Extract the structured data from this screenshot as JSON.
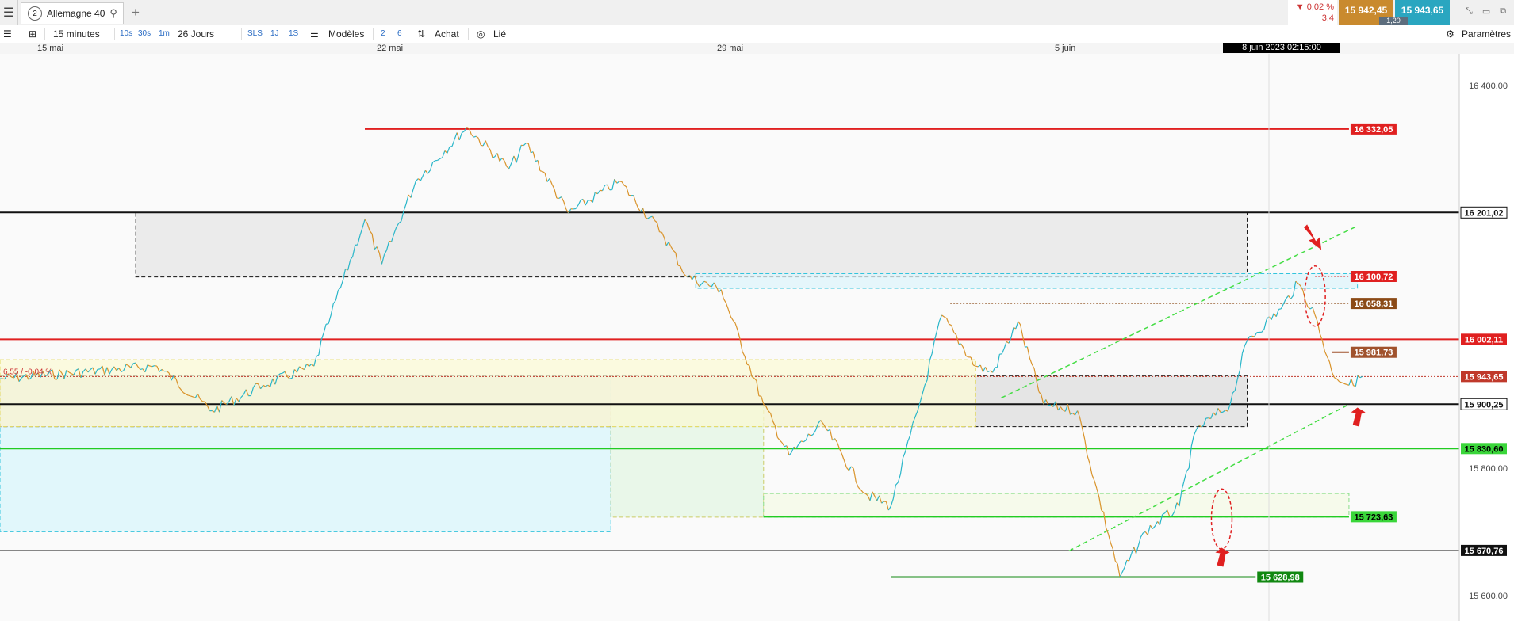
{
  "tabbar": {
    "tab_number": "2",
    "tab_title": "Allemagne 40",
    "change_pct": "▼ 0,02 %",
    "change_abs": "3,4",
    "bid": "15 942,45",
    "ask": "15 943,65",
    "spread": "1,20"
  },
  "toolbar": {
    "interval": "15 minutes",
    "q10s": "10s",
    "q30s": "30s",
    "q1m": "1m",
    "period": "26 Jours",
    "sls": "SLS",
    "q1j": "1J",
    "q1s": "1S",
    "models": "Modèles",
    "n2": "2",
    "n6": "6",
    "buy": "Achat",
    "linked": "Lié",
    "settings": "Paramètres"
  },
  "datebar": {
    "d1": "15 mai",
    "d2": "22 mai",
    "d3": "29 mai",
    "d4": "5 juin",
    "cursor": "8 juin 2023 02:15:00"
  },
  "colors": {
    "up": "#29b6c9",
    "down": "#d9932a",
    "red_line": "#e02020",
    "green_line": "#22cc22",
    "dark_green": "#118811",
    "price_tag": "#c0392b",
    "bid_color": "#c98a2e",
    "ask_color": "#2aa6c0"
  },
  "chart_data": {
    "type": "line",
    "title": "Allemagne 40",
    "x_range": [
      "2023-05-12",
      "2023-06-08"
    ],
    "ylim": [
      15560,
      16450
    ],
    "y_ticks": [
      "16 400,00",
      "15 800,00",
      "15 600,00"
    ],
    "price_series": [
      {
        "date": "2023-05-12 08:00",
        "value": 15940
      },
      {
        "date": "2023-05-15 10:00",
        "value": 15960
      },
      {
        "date": "2023-05-16 12:00",
        "value": 15890
      },
      {
        "date": "2023-05-17 12:00",
        "value": 15930
      },
      {
        "date": "2023-05-18 12:00",
        "value": 15960
      },
      {
        "date": "2023-05-18 20:00",
        "value": 16040
      },
      {
        "date": "2023-05-19 12:00",
        "value": 16190
      },
      {
        "date": "2023-05-19 20:00",
        "value": 16120
      },
      {
        "date": "2023-05-20 12:00",
        "value": 16250
      },
      {
        "date": "2023-05-21 12:00",
        "value": 16335
      },
      {
        "date": "2023-05-22 08:00",
        "value": 16270
      },
      {
        "date": "2023-05-22 16:00",
        "value": 16310
      },
      {
        "date": "2023-05-23 12:00",
        "value": 16200
      },
      {
        "date": "2023-05-24 12:00",
        "value": 16250
      },
      {
        "date": "2023-05-25 08:00",
        "value": 16170
      },
      {
        "date": "2023-05-25 20:00",
        "value": 16100
      },
      {
        "date": "2023-05-26 12:00",
        "value": 16080
      },
      {
        "date": "2023-05-27 08:00",
        "value": 15900
      },
      {
        "date": "2023-05-27 20:00",
        "value": 15820
      },
      {
        "date": "2023-05-28 12:00",
        "value": 15870
      },
      {
        "date": "2023-05-29 08:00",
        "value": 15760
      },
      {
        "date": "2023-05-29 20:00",
        "value": 15740
      },
      {
        "date": "2023-05-30 12:00",
        "value": 15930
      },
      {
        "date": "2023-05-30 20:00",
        "value": 16040
      },
      {
        "date": "2023-05-31 12:00",
        "value": 15960
      },
      {
        "date": "2023-05-31 20:00",
        "value": 15950
      },
      {
        "date": "2023-06-01 08:00",
        "value": 16030
      },
      {
        "date": "2023-06-01 20:00",
        "value": 15900
      },
      {
        "date": "2023-06-02 12:00",
        "value": 15890
      },
      {
        "date": "2023-06-02 20:00",
        "value": 15780
      },
      {
        "date": "2023-06-03 08:00",
        "value": 15629
      },
      {
        "date": "2023-06-03 20:00",
        "value": 15700
      },
      {
        "date": "2023-06-04 12:00",
        "value": 15740
      },
      {
        "date": "2023-06-04 20:00",
        "value": 15860
      },
      {
        "date": "2023-06-05 12:00",
        "value": 15900
      },
      {
        "date": "2023-06-05 20:00",
        "value": 16000
      },
      {
        "date": "2023-06-06 12:00",
        "value": 16050
      },
      {
        "date": "2023-06-06 20:00",
        "value": 16090
      },
      {
        "date": "2023-06-07 04:00",
        "value": 16040
      },
      {
        "date": "2023-06-07 12:00",
        "value": 15950
      },
      {
        "date": "2023-06-07 20:00",
        "value": 15930
      },
      {
        "date": "2023-06-08 02:15",
        "value": 15943.65
      }
    ],
    "levels": [
      {
        "value": 16332.05,
        "label": "16 332,05",
        "color": "#e02020",
        "from": "2023-05-19 12:00",
        "to": "2023-06-07 20:00"
      },
      {
        "value": 16201.02,
        "label": "16 201,02",
        "color": "#111111",
        "from": "2023-05-12 08:00",
        "to": "2023-06-10 00:00"
      },
      {
        "value": 16100.72,
        "label": "16 100,72",
        "color": "#e02020",
        "from": "2023-06-07 04:00",
        "to": "2023-06-07 20:00",
        "dotted": true
      },
      {
        "value": 16058.31,
        "label": "16 058,31",
        "color": "#8b4a16",
        "from": "2023-05-31 00:00",
        "to": "2023-06-07 20:00",
        "dotted": true
      },
      {
        "value": 16002.11,
        "label": "16 002,11",
        "color": "#e02020",
        "from": "2023-05-12 08:00",
        "to": "2023-06-10 00:00"
      },
      {
        "value": 15981.73,
        "label": "15 981,73",
        "color": "#a0522d",
        "from": "2023-06-07 12:00",
        "to": "2023-06-07 20:00"
      },
      {
        "value": 15943.65,
        "label": "15 943,65",
        "color": "#c0392b",
        "from": "2023-05-12 08:00",
        "to": "2023-06-10 00:00",
        "dotted": true
      },
      {
        "value": 15900.25,
        "label": "15 900,25",
        "color": "#111111",
        "from": "2023-05-12 08:00",
        "to": "2023-06-10 00:00"
      },
      {
        "value": 15830.6,
        "label": "15 830,60",
        "color": "#22cc22",
        "from": "2023-05-12 08:00",
        "to": "2023-06-10 00:00"
      },
      {
        "value": 15723.63,
        "label": "15 723,63",
        "color": "#22cc22",
        "from": "2023-05-27 08:00",
        "to": "2023-06-07 20:00"
      },
      {
        "value": 15670.76,
        "label": "15 670,76",
        "color": "#111111",
        "from": "2023-05-12 08:00",
        "to": "2023-06-10 00:00",
        "thin": true
      },
      {
        "value": 15628.98,
        "label": "15 628,98",
        "color": "#118811",
        "from": "2023-05-29 20:00",
        "to": "2023-06-06 00:00"
      }
    ],
    "zones": [
      {
        "from": "2023-05-15 00:00",
        "to": "2023-06-05 20:00",
        "low": 16100,
        "high": 16201,
        "fill": "#e6e6e6",
        "stroke": "#111111"
      },
      {
        "from": "2023-05-26 00:00",
        "to": "2023-06-08 00:00",
        "low": 16082,
        "high": 16105,
        "fill": "#ddf4fb",
        "stroke": "#33c4dd"
      },
      {
        "from": "2023-05-12 08:00",
        "to": "2023-05-24 08:00",
        "low": 15700,
        "high": 15945,
        "fill": "#d8f5fb",
        "stroke": "#33c4dd"
      },
      {
        "from": "2023-05-12 08:00",
        "to": "2023-06-05 20:00",
        "low": 15865,
        "high": 15945,
        "fill": "#dddddd",
        "stroke": "#111111"
      },
      {
        "from": "2023-05-24 08:00",
        "to": "2023-05-27 08:00",
        "low": 15723,
        "high": 15900,
        "fill": "#e3f5e3",
        "stroke": "#cccc66"
      },
      {
        "from": "2023-05-27 08:00",
        "to": "2023-06-07 20:00",
        "low": 15723,
        "high": 15760,
        "fill": "#f4f9e6",
        "stroke": "#88dd88"
      },
      {
        "from": "2023-05-12 08:00",
        "to": "2023-05-31 12:00",
        "low": 15865,
        "high": 15970,
        "fill": "#fbf9d6",
        "stroke": "#e3d95c"
      }
    ],
    "trend_lines": [
      {
        "from": "2023-06-02 08:00",
        "to": "2023-06-07 20:00",
        "start": 15670,
        "end": 15900,
        "color": "#44dd44"
      },
      {
        "from": "2023-06-01 00:00",
        "to": "2023-06-08 00:00",
        "start": 15910,
        "end": 16180,
        "color": "#44dd44"
      }
    ],
    "markers": [
      {
        "type": "ellipse",
        "date": "2023-06-07 04:00",
        "value": 16070,
        "color": "#e02020"
      },
      {
        "type": "ellipse",
        "date": "2023-06-05 08:00",
        "value": 15720,
        "color": "#e02020"
      },
      {
        "type": "arrow-down",
        "date": "2023-06-07 04:00",
        "value": 16150,
        "color": "#e02020"
      },
      {
        "type": "arrow-up",
        "date": "2023-06-05 08:00",
        "value": 15675,
        "color": "#e02020"
      },
      {
        "type": "arrow-up",
        "date": "2023-06-08 00:00",
        "value": 15895,
        "color": "#e02020"
      }
    ],
    "grid": false,
    "legend": "none",
    "annotation": "6,55 / -0,04 %"
  }
}
